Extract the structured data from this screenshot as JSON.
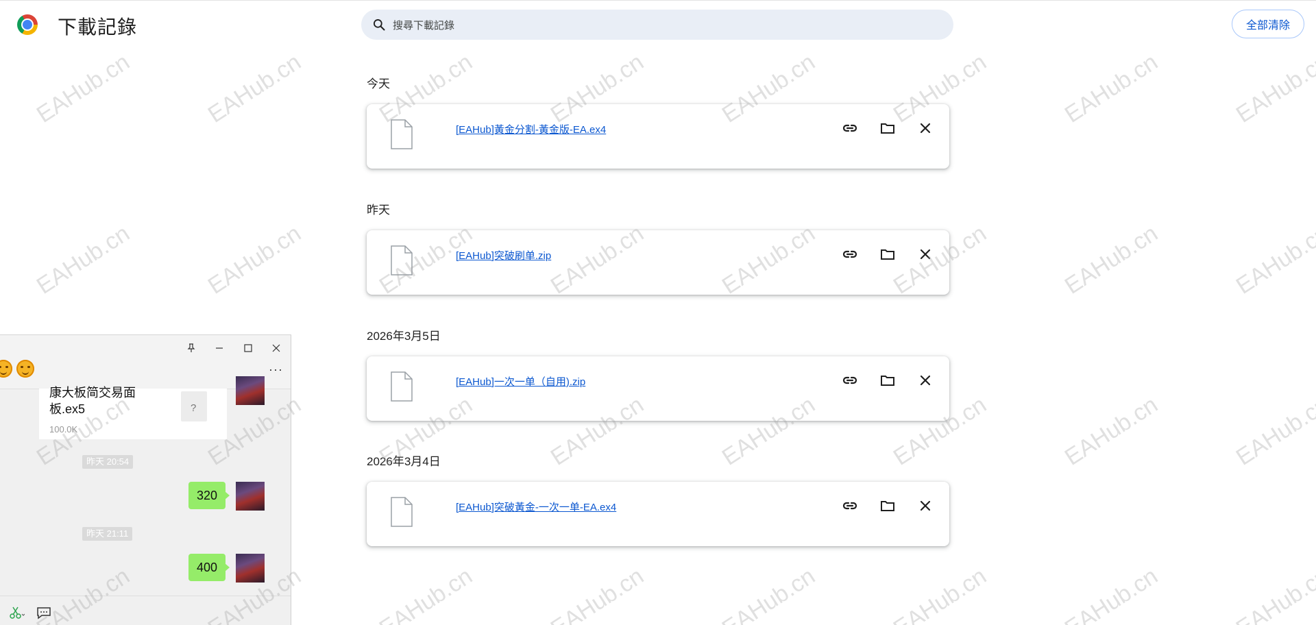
{
  "header": {
    "title": "下載記錄",
    "search_placeholder": "搜尋下載記錄",
    "clear_all_label": "全部清除"
  },
  "groups": [
    {
      "date": "今天",
      "file": "[EAHub]黃金分割-黃金版-EA.ex4"
    },
    {
      "date": "昨天",
      "file": "[EAHub]突破刷单.zip"
    },
    {
      "date": "2026年3月5日",
      "file": "[EAHub]一次一单（自用).zip"
    },
    {
      "date": "2026年3月4日",
      "file": "[EAHub]突破黃金-一次一单-EA.ex4"
    }
  ],
  "chat": {
    "file_message": {
      "name": "康大板简交易面板.ex5",
      "size": "100.0K",
      "icon_mark": "?"
    },
    "messages": [
      {
        "time": "昨天 20:54",
        "text": "320"
      },
      {
        "time": "昨天 21:11",
        "text": "400"
      }
    ],
    "window_controls": [
      "pin-icon",
      "minimize-icon",
      "maximize-icon",
      "close-icon"
    ],
    "more_label": "···"
  },
  "watermark": "EAHub.cn",
  "colors": {
    "accent": "#0b57d0",
    "search_bg": "#e9eef6",
    "chat_bubble": "#95ec69",
    "chat_bg": "#f0f0f0"
  },
  "icons": {
    "card_actions": [
      "link-icon",
      "folder-icon",
      "close-icon"
    ],
    "file": "file-icon",
    "search": "search-icon",
    "chat_tools": [
      "scissors-icon",
      "chat-bubble-icon"
    ]
  }
}
